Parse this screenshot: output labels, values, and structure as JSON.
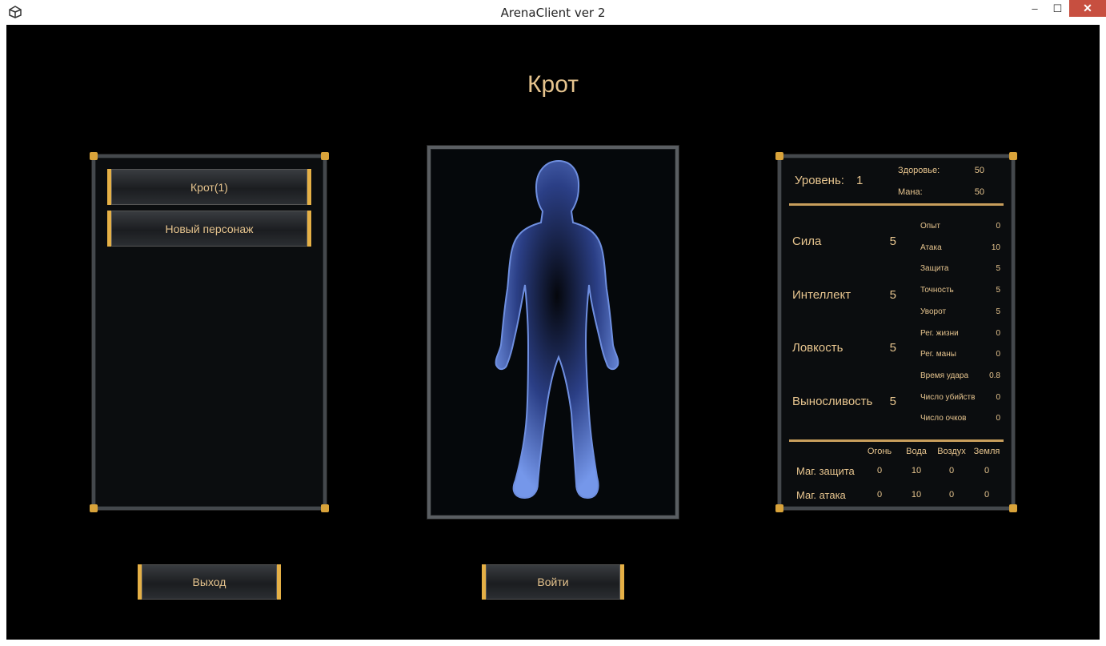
{
  "window": {
    "title": "ArenaClient ver 2",
    "minimize": "–",
    "maximize": "☐",
    "close": "✕",
    "app_icon": "unity-icon"
  },
  "character": {
    "title": "Крот"
  },
  "char_list": {
    "items": [
      "Крот(1)",
      "Новый персонаж"
    ]
  },
  "buttons": {
    "exit": "Выход",
    "enter": "Войти"
  },
  "stats": {
    "level_label": "Уровень:",
    "level_value": "1",
    "health_label": "Здоровье:",
    "health_value": "50",
    "mana_label": "Мана:",
    "mana_value": "50",
    "primary": [
      {
        "label": "Сила",
        "value": "5"
      },
      {
        "label": "Интеллект",
        "value": "5"
      },
      {
        "label": "Ловкость",
        "value": "5"
      },
      {
        "label": "Выносливость",
        "value": "5"
      }
    ],
    "secondary": [
      {
        "label": "Опыт",
        "value": "0"
      },
      {
        "label": "Атака",
        "value": "10"
      },
      {
        "label": "Защита",
        "value": "5"
      },
      {
        "label": "Точность",
        "value": "5"
      },
      {
        "label": "Уворот",
        "value": "5"
      },
      {
        "label": "Рег. жизни",
        "value": "0"
      },
      {
        "label": "Рег. маны",
        "value": "0"
      },
      {
        "label": "Время удара",
        "value": "0.8"
      },
      {
        "label": "Число убийств",
        "value": "0"
      },
      {
        "label": "Число очков",
        "value": "0"
      }
    ],
    "magic_headers": [
      "Огонь",
      "Вода",
      "Воздух",
      "Земля"
    ],
    "magic_rows": [
      {
        "label": "Маг. защита",
        "values": [
          "0",
          "10",
          "0",
          "0"
        ]
      },
      {
        "label": "Маг. атака",
        "values": [
          "0",
          "10",
          "0",
          "0"
        ]
      }
    ]
  },
  "colors": {
    "accent": "#e6c48e",
    "gold": "#e5b046",
    "figure": "#6f8fe0"
  }
}
